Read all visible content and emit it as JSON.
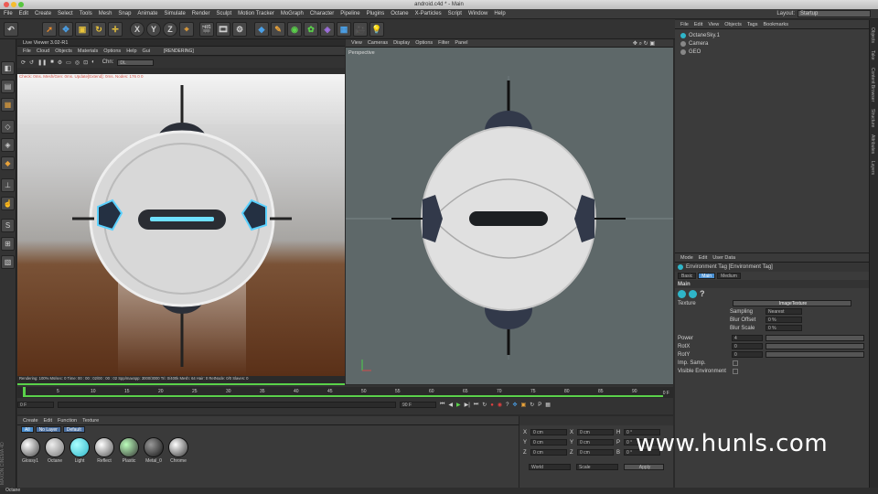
{
  "window": {
    "title": "android.c4d * - Main"
  },
  "menu": [
    "File",
    "Edit",
    "Create",
    "Select",
    "Tools",
    "Mesh",
    "Snap",
    "Animate",
    "Simulate",
    "Render",
    "Sculpt",
    "Motion Tracker",
    "MoGraph",
    "Character",
    "Pipeline",
    "Plugins",
    "Octane",
    "X-Particles",
    "Script",
    "Window",
    "Help"
  ],
  "layout": {
    "label": "Layout:",
    "value": "Startup"
  },
  "toolbar": {
    "x": "X",
    "y": "Y",
    "z": "Z"
  },
  "liveviewer": {
    "title": "Live Viewer 3.02-R1",
    "menu": [
      "File",
      "Cloud",
      "Objects",
      "Materials",
      "Options",
      "Help",
      "Gui"
    ],
    "status_tag": "[RENDERING]",
    "chn_label": "Chn:",
    "chn_value": "DL",
    "info": "Check: 0ms. Mesh/Gen: 0ms. Update[Extend]: 0ms. Nodes: 176  0 0",
    "footer": "Rendering: 100%   Ms/sec: 0   Time: 00 : 00 : 02/00 : 00 : 02   Spp/maxspp: 3000/3000   Tri: 0/400k   Mesh: 64   Hair: 0   RetNode: 0/0   Slaves: 0"
  },
  "viewport": {
    "menu": [
      "View",
      "Cameras",
      "Display",
      "Options",
      "Filter",
      "Panel"
    ],
    "label": "Perspective"
  },
  "objects": {
    "menu": [
      "File",
      "Edit",
      "View",
      "Objects",
      "Tags",
      "Bookmarks"
    ],
    "items": [
      "OctaneSky.1",
      "Camera",
      "GEO"
    ]
  },
  "attributes": {
    "menu": [
      "Mode",
      "Edit",
      "User Data"
    ],
    "title": "Environment Tag [Environment Tag]",
    "tabs": [
      "Basic",
      "Main",
      "Medium"
    ],
    "section": "Main",
    "texture_label": "Texture",
    "texture_value": "ImageTexture",
    "sub": [
      {
        "label": "Sampling",
        "value": "Nearest"
      },
      {
        "label": "Blur Offset",
        "value": "0 %"
      },
      {
        "label": "Blur Scale",
        "value": "0 %"
      }
    ],
    "params": [
      {
        "label": "Power",
        "value": "4"
      },
      {
        "label": "RotX",
        "value": "0"
      },
      {
        "label": "RotY",
        "value": "0"
      }
    ],
    "imp_samp": "Imp. Samp.",
    "visible_env": "Visible Environment"
  },
  "sidetabs": [
    "Objects",
    "Take",
    "Content Browser",
    "Structure",
    "Attributes",
    "Layers"
  ],
  "timeline": {
    "ticks": [
      "0",
      "5",
      "10",
      "15",
      "20",
      "25",
      "30",
      "35",
      "40",
      "45",
      "50",
      "55",
      "60",
      "65",
      "70",
      "75",
      "80",
      "85",
      "90"
    ],
    "start": "0 F",
    "end": "90 F",
    "current": "0 F",
    "field_left": "0 F",
    "field_right": "90 F"
  },
  "materials": {
    "menu": [
      "Create",
      "Edit",
      "Function",
      "Texture"
    ],
    "filters": [
      "All",
      "No Layer",
      "Default"
    ],
    "items": [
      "Glossy1",
      "Octane",
      "Light",
      "Reflect",
      "Plastic",
      "Metal_0",
      "Chrome"
    ]
  },
  "coords": {
    "rows": [
      {
        "a": "X",
        "av": "0 cm",
        "b": "X",
        "bv": "0 cm",
        "c": "H",
        "cv": "0 °"
      },
      {
        "a": "Y",
        "av": "0 cm",
        "b": "Y",
        "bv": "0 cm",
        "c": "P",
        "cv": "0 °"
      },
      {
        "a": "Z",
        "av": "0 cm",
        "b": "Z",
        "bv": "0 cm",
        "c": "B",
        "cv": "0 °"
      }
    ],
    "mode1": "World",
    "mode2": "Scale",
    "apply": "Apply"
  },
  "status": {
    "text": "Octane"
  },
  "watermark": "www.hunls.com",
  "colors": {
    "accent": "#4a8fd0",
    "render_floor": "#6b3d22",
    "viewport_bg": "#5e6869",
    "timeline_green": "#5ad14a"
  }
}
